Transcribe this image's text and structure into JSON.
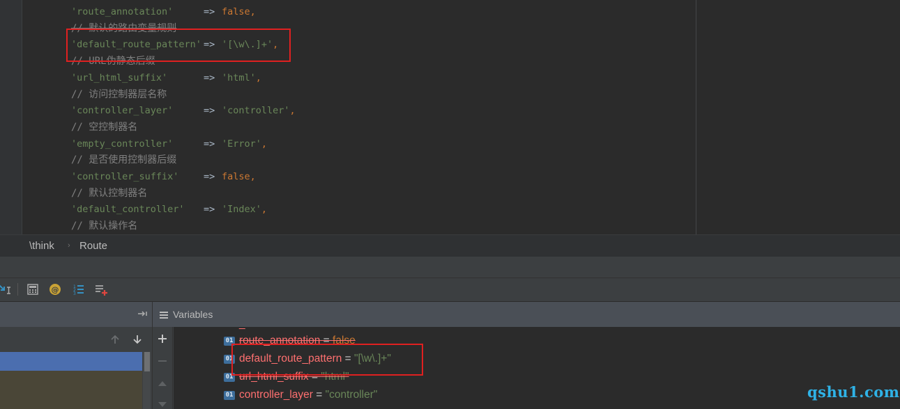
{
  "editor": {
    "lines": [
      {
        "kind": "kv",
        "key": "'route_annotation'",
        "arrow": "=>",
        "value": "false",
        "value_type": "kw",
        "comma": ","
      },
      {
        "kind": "comment",
        "text": "// 默认的路由变量规则",
        "strike": true
      },
      {
        "kind": "kv",
        "key": "'default_route_pattern'",
        "arrow": "=>",
        "value": "'[\\w\\.]+'",
        "value_type": "str",
        "comma": ","
      },
      {
        "kind": "comment",
        "text": "// URL伪静态后缀",
        "strike": true
      },
      {
        "kind": "kv",
        "key": "'url_html_suffix'",
        "arrow": "=>",
        "value": "'html'",
        "value_type": "str",
        "comma": ","
      },
      {
        "kind": "comment",
        "text": "// 访问控制器层名称",
        "strike": false
      },
      {
        "kind": "kv",
        "key": "'controller_layer'",
        "arrow": "=>",
        "value": "'controller'",
        "value_type": "str",
        "comma": ","
      },
      {
        "kind": "comment",
        "text": "// 空控制器名",
        "strike": false
      },
      {
        "kind": "kv",
        "key": "'empty_controller'",
        "arrow": "=>",
        "value": "'Error'",
        "value_type": "str",
        "comma": ","
      },
      {
        "kind": "comment",
        "text": "// 是否使用控制器后缀",
        "strike": false
      },
      {
        "kind": "kv",
        "key": "'controller_suffix'",
        "arrow": "=>",
        "value": "false",
        "value_type": "kw",
        "comma": ","
      },
      {
        "kind": "comment",
        "text": "// 默认控制器名",
        "strike": false
      },
      {
        "kind": "kv",
        "key": "'default_controller'",
        "arrow": "=>",
        "value": "'Index'",
        "value_type": "str",
        "comma": ","
      },
      {
        "kind": "comment",
        "text": "// 默认操作名",
        "strike": false
      }
    ]
  },
  "breadcrumb": {
    "items": [
      "\\think",
      "Route"
    ],
    "separator": "›"
  },
  "toolbar": {
    "icons": [
      "step-cursor-icon",
      "evaluate-expression-icon",
      "watch-icon",
      "frames-list-icon",
      "restore-layout-icon"
    ]
  },
  "debugger": {
    "variables_title": "Variables",
    "variables": [
      {
        "type_badge": "01",
        "name": "route_annotation",
        "eq": " = ",
        "value": "false",
        "value_type": "kw",
        "strike": true
      },
      {
        "type_badge": "01",
        "name": "default_route_pattern",
        "eq": " = ",
        "value": "\"[\\w\\.]+\"",
        "value_type": "str",
        "strike": false
      },
      {
        "type_badge": "01",
        "name": "url_html_suffix",
        "eq": " = ",
        "value": "\"html\"",
        "value_type": "str",
        "strike": true
      },
      {
        "type_badge": "01",
        "name": "controller_layer",
        "eq": " = ",
        "value": "\"controller\"",
        "value_type": "str",
        "strike": false
      }
    ]
  },
  "watermark": "qshu1.com",
  "colors": {
    "editor_bg": "#2b2b2b",
    "string": "#6a8759",
    "keyword": "#cc7832",
    "comment": "#808080",
    "var_name": "#ff7070",
    "highlight_box": "#e02020",
    "selection": "#4b6eaf",
    "watermark": "#2fb2e6"
  }
}
